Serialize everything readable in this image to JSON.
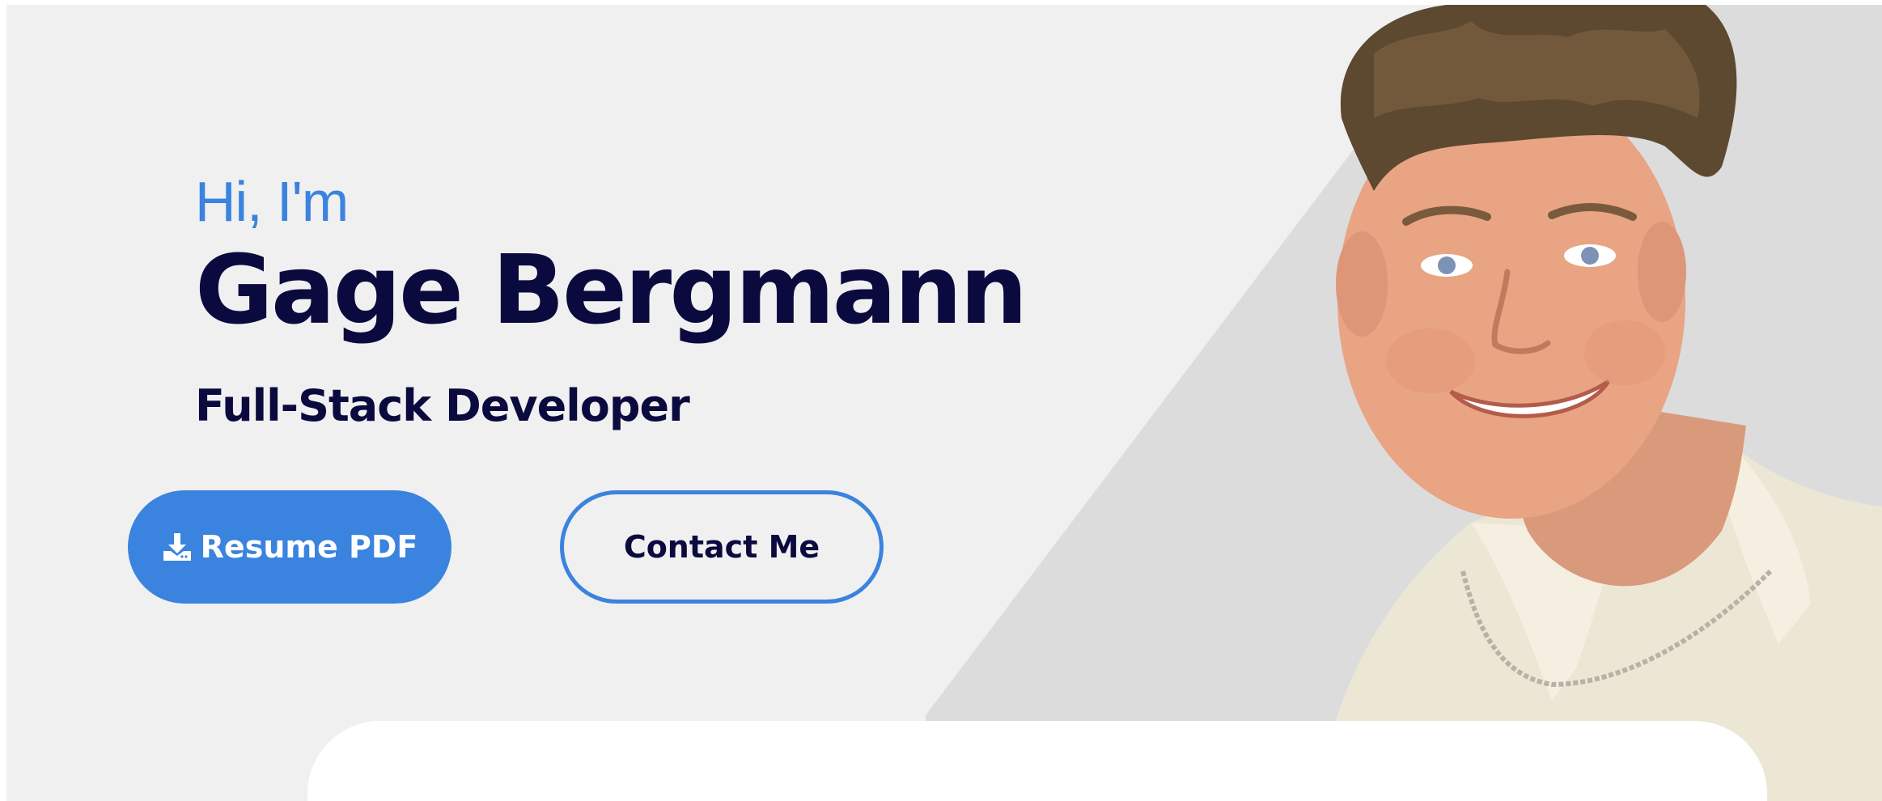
{
  "hero": {
    "greeting": "Hi, I'm",
    "name": "Gage Bergmann",
    "role": "Full-Stack Developer",
    "photo_icon": "portrait-photo"
  },
  "buttons": {
    "resume": {
      "label": "Resume PDF",
      "icon": "download-icon"
    },
    "contact": {
      "label": "Contact Me"
    }
  },
  "colors": {
    "background": "#f0f0f0",
    "diagonal_panel": "#dcdcdc",
    "accent": "#3a83de",
    "heading": "#0b0a3f",
    "card": "#ffffff"
  }
}
